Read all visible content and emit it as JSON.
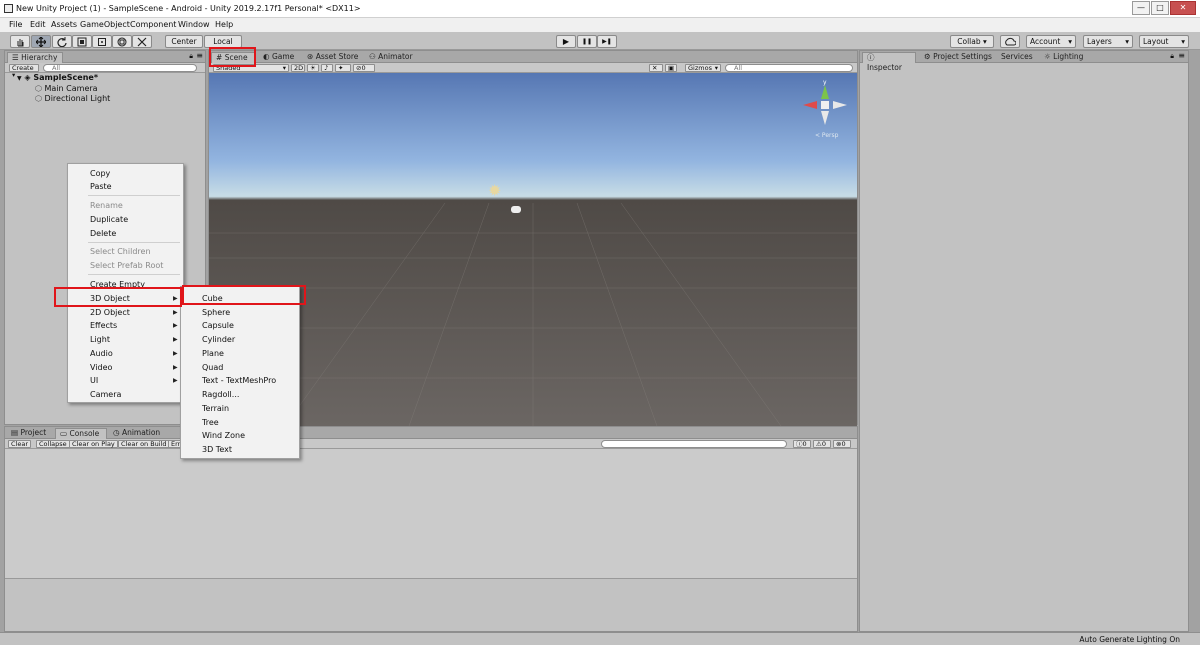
{
  "window": {
    "title": "New Unity Project (1) - SampleScene - Android - Unity 2019.2.17f1 Personal* <DX11>",
    "minimize": "—",
    "maximize": "□",
    "close": "✕"
  },
  "menubar": [
    "File",
    "Edit",
    "Assets",
    "GameObject",
    "Component",
    "Window",
    "Help"
  ],
  "toolbar": {
    "tools": [
      "hand-icon",
      "move-icon",
      "rotate-icon",
      "scale-icon",
      "rect-icon",
      "transform-icon",
      "custom-tool-icon"
    ],
    "pivot": "Center",
    "space": "Local",
    "play": "▶",
    "pause": "❚❚",
    "step": "▶❚",
    "collab": "Collab ▾",
    "account": "Account",
    "layers": "Layers",
    "layout": "Layout"
  },
  "hierarchy": {
    "tab": "Hierarchy",
    "create": "Create ▾",
    "search_placeholder": "All",
    "scene": "SampleScene*",
    "items": [
      "Main Camera",
      "Directional Light"
    ]
  },
  "scene_tabs": [
    "Scene",
    "Game",
    "Asset Store",
    "Animator"
  ],
  "scene_toolbar": {
    "shading": "Shaded",
    "mode_2d": "2D",
    "effects_count": "0",
    "gizmos": "Gizmos",
    "search_placeholder": "All"
  },
  "gizmo": {
    "y": "y",
    "persp": "< Persp"
  },
  "inspector_tabs": [
    "Inspector",
    "Project Settings",
    "Services",
    "Lighting"
  ],
  "bottom_tabs": [
    "Project",
    "Console",
    "Animation"
  ],
  "console_toolbar": [
    "Clear",
    "Collapse",
    "Clear on Play",
    "Clear on Build",
    "Error"
  ],
  "console_counts": [
    "0",
    "0",
    "0"
  ],
  "context_menu": {
    "items": [
      {
        "label": "Copy",
        "enabled": true
      },
      {
        "label": "Paste",
        "enabled": true
      },
      {
        "label": "Rename",
        "enabled": false
      },
      {
        "label": "Duplicate",
        "enabled": true
      },
      {
        "label": "Delete",
        "enabled": true
      },
      {
        "label": "Select Children",
        "enabled": false
      },
      {
        "label": "Select Prefab Root",
        "enabled": false
      },
      {
        "label": "Create Empty",
        "enabled": true
      },
      {
        "label": "3D Object",
        "enabled": true,
        "submenu": true
      },
      {
        "label": "2D Object",
        "enabled": true,
        "submenu": true
      },
      {
        "label": "Effects",
        "enabled": true,
        "submenu": true
      },
      {
        "label": "Light",
        "enabled": true,
        "submenu": true
      },
      {
        "label": "Audio",
        "enabled": true,
        "submenu": true
      },
      {
        "label": "Video",
        "enabled": true,
        "submenu": true
      },
      {
        "label": "UI",
        "enabled": true,
        "submenu": true
      },
      {
        "label": "Camera",
        "enabled": true
      }
    ]
  },
  "submenu_3d": [
    "Cube",
    "Sphere",
    "Capsule",
    "Cylinder",
    "Plane",
    "Quad",
    "Text - TextMeshPro",
    "Ragdoll...",
    "Terrain",
    "Tree",
    "Wind Zone",
    "3D Text"
  ],
  "status": "Auto Generate Lighting On",
  "colors": {
    "highlight": "#e0151a",
    "panel": "#c2c2c2",
    "sky": "#93b5e0",
    "ground": "#5c5754"
  }
}
